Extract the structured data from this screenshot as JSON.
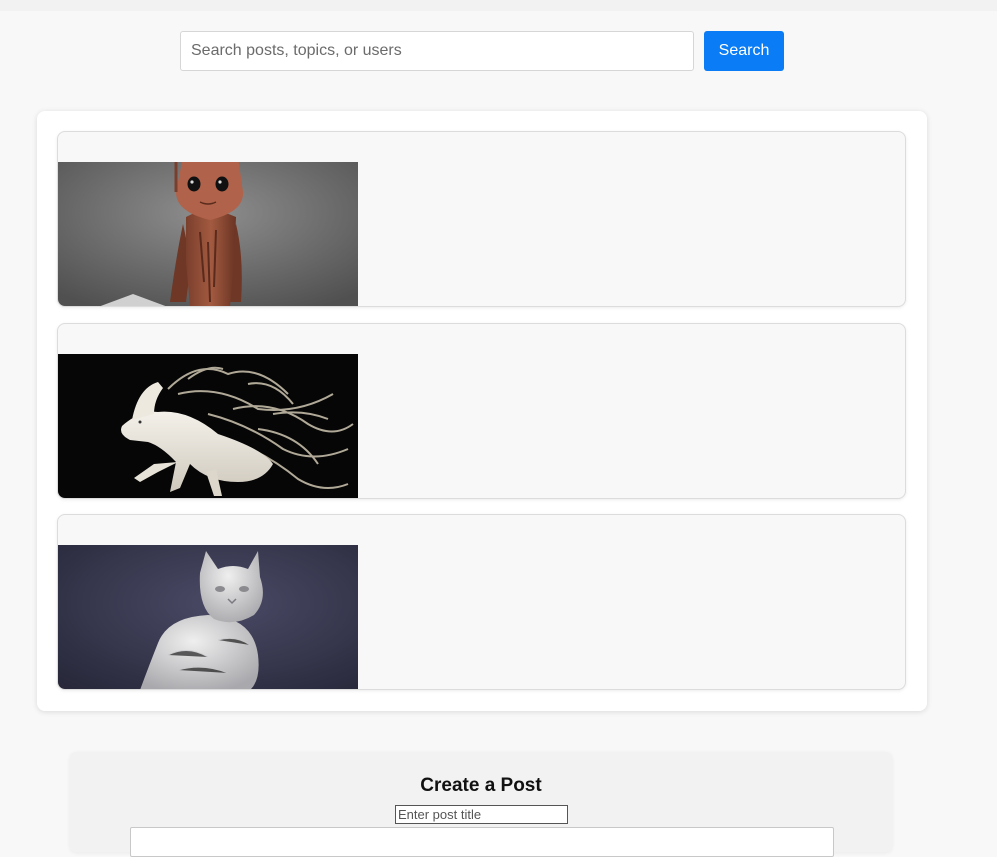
{
  "search": {
    "placeholder": "Search posts, topics, or users",
    "button_label": "Search"
  },
  "posts": [
    {
      "image_alt": "Baby Groot wooden figure render"
    },
    {
      "image_alt": "White horse sculpture with flowing mane"
    },
    {
      "image_alt": "Carved stone cat statue"
    }
  ],
  "create_post": {
    "heading": "Create a Post",
    "title_placeholder": "Enter post title"
  },
  "colors": {
    "accent": "#0a7cf5",
    "page_background": "#f8f8f8"
  }
}
